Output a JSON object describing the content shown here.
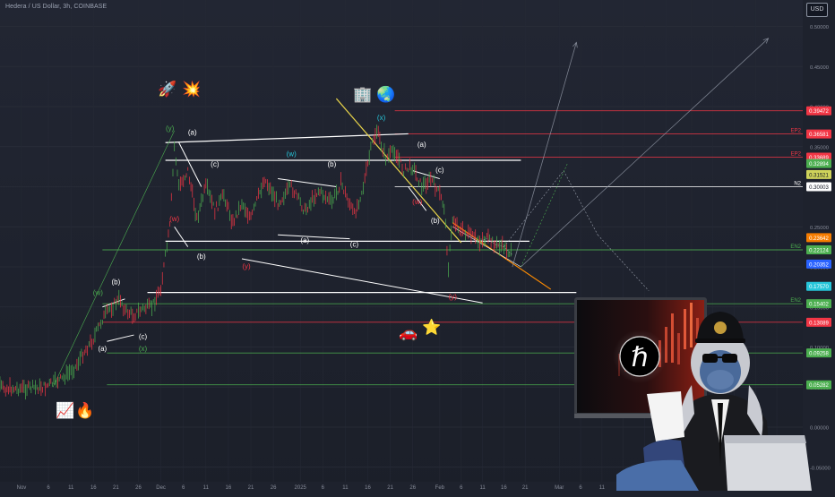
{
  "header": {
    "symbol_title": "Hedera / US Dollar, 3h, COINBASE",
    "currency": "USD"
  },
  "chart_data": {
    "type": "line",
    "title": "Hedera / US Dollar, 3h, COINBASE",
    "ylabel": "USD",
    "scale": "linear",
    "ylim": [
      -0.05,
      0.56
    ],
    "y_ticks": [
      "0.55000",
      "0.50000",
      "0.45000",
      "0.40000",
      "0.35000",
      "0.30000",
      "0.25000",
      "0.20000",
      "0.15000",
      "0.10000",
      "0.05000",
      "0.00000",
      "-0.05000"
    ],
    "x_ticks": [
      "Nov",
      "6",
      "11",
      "16",
      "21",
      "26",
      "Dec",
      "6",
      "11",
      "16",
      "21",
      "26",
      "2025",
      "6",
      "11",
      "16",
      "21",
      "26",
      "Feb",
      "6",
      "11",
      "16",
      "21",
      "Mar",
      "6",
      "11",
      "16",
      "21",
      "26",
      "Apr",
      "6",
      "11",
      "16",
      "21"
    ],
    "price_path": [
      [
        "Oct 24",
        0.05
      ],
      [
        "Oct 30",
        0.048
      ],
      [
        "Nov 5",
        0.05
      ],
      [
        "Nov 9",
        0.06
      ],
      [
        "Nov 12",
        0.075
      ],
      [
        "Nov 14",
        0.095
      ],
      [
        "Nov 16",
        0.11
      ],
      [
        "Nov 18",
        0.135
      ],
      [
        "Nov 20",
        0.15
      ],
      [
        "Nov 22",
        0.16
      ],
      [
        "Nov 23",
        0.145
      ],
      [
        "Nov 25",
        0.14
      ],
      [
        "Nov 27",
        0.148
      ],
      [
        "Nov 29",
        0.15
      ],
      [
        "Dec 1",
        0.175
      ],
      [
        "Dec 3",
        0.25
      ],
      [
        "Dec 4",
        0.35
      ],
      [
        "Dec 5",
        0.3
      ],
      [
        "Dec 7",
        0.32
      ],
      [
        "Dec 9",
        0.26
      ],
      [
        "Dec 11",
        0.3
      ],
      [
        "Dec 13",
        0.27
      ],
      [
        "Dec 15",
        0.29
      ],
      [
        "Dec 17",
        0.255
      ],
      [
        "Dec 19",
        0.28
      ],
      [
        "Dec 21",
        0.26
      ],
      [
        "Dec 24",
        0.31
      ],
      [
        "Dec 27",
        0.28
      ],
      [
        "Dec 30",
        0.3
      ],
      [
        "Jan 2",
        0.27
      ],
      [
        "Jan 5",
        0.295
      ],
      [
        "Jan 8",
        0.28
      ],
      [
        "Jan 10",
        0.305
      ],
      [
        "Jan 13",
        0.265
      ],
      [
        "Jan 15",
        0.3
      ],
      [
        "Jan 17",
        0.355
      ],
      [
        "Jan 18",
        0.37
      ],
      [
        "Jan 20",
        0.335
      ],
      [
        "Jan 22",
        0.345
      ],
      [
        "Jan 24",
        0.32
      ],
      [
        "Jan 26",
        0.325
      ],
      [
        "Jan 28",
        0.3
      ],
      [
        "Jan 30",
        0.31
      ],
      [
        "Feb 1",
        0.29
      ],
      [
        "Feb 2",
        0.275
      ],
      [
        "Feb 3",
        0.2
      ],
      [
        "Feb 4",
        0.26
      ],
      [
        "Feb 6",
        0.245
      ],
      [
        "Feb 8",
        0.24
      ],
      [
        "Feb 10",
        0.232
      ],
      [
        "Feb 12",
        0.235
      ],
      [
        "Feb 14",
        0.228
      ],
      [
        "Feb 16",
        0.225
      ],
      [
        "Feb 18",
        0.215
      ]
    ],
    "price_labels": [
      {
        "value": 0.39472,
        "text": "0.39472",
        "color": "#f23645"
      },
      {
        "value": 0.36581,
        "text": "0.36581",
        "color": "#f23645"
      },
      {
        "value": 0.33689,
        "text": "0.33689",
        "color": "#f23645"
      },
      {
        "value": 0.32894,
        "text": "0.32894",
        "color": "#4caf50"
      },
      {
        "value": 0.31521,
        "text": "0.31521",
        "color": "#cfd35a"
      },
      {
        "value": 0.30003,
        "text": "0.30003",
        "color": "#ffffff"
      },
      {
        "value": 0.23642,
        "text": "0.23642",
        "color": "#f57c00"
      },
      {
        "value": 0.22124,
        "text": "0.22124",
        "color": "#4caf50"
      },
      {
        "value": 0.20352,
        "text": "0.20352",
        "color": "#2962ff"
      },
      {
        "value": 0.1757,
        "text": "0.17570",
        "color": "#26c6da"
      },
      {
        "value": 0.15402,
        "text": "0.15402",
        "color": "#4caf50"
      },
      {
        "value": 0.13089,
        "text": "0.13089",
        "color": "#f23645"
      },
      {
        "value": 0.09258,
        "text": "0.09258",
        "color": "#4caf50"
      },
      {
        "value": 0.05282,
        "text": "0.05282",
        "color": "#4caf50"
      }
    ],
    "level_lines": [
      {
        "value": 0.39472,
        "color": "#f23645",
        "tag": ""
      },
      {
        "value": 0.36581,
        "color": "#f23645",
        "tag": "EP2"
      },
      {
        "value": 0.33689,
        "color": "#f23645",
        "tag": "EP2"
      },
      {
        "value": 0.30003,
        "color": "#ffffff",
        "tag": "N2"
      },
      {
        "value": 0.22124,
        "color": "#4caf50",
        "tag": "EN2"
      },
      {
        "value": 0.15402,
        "color": "#4caf50",
        "tag": "EN2"
      },
      {
        "value": 0.13089,
        "color": "#f23645",
        "tag": ""
      },
      {
        "value": 0.09258,
        "color": "#4caf50",
        "tag": ""
      },
      {
        "value": 0.05282,
        "color": "#4caf50",
        "tag": ""
      }
    ],
    "wave_labels": [
      {
        "text": "(w)",
        "date": "Nov 17",
        "value": 0.165,
        "color": "#4caf50"
      },
      {
        "text": "(b)",
        "date": "Nov 21",
        "value": 0.178,
        "color": "#ffffff"
      },
      {
        "text": "(c)",
        "date": "Nov 27",
        "value": 0.11,
        "color": "#ffffff"
      },
      {
        "text": "(a)",
        "date": "Nov 18",
        "value": 0.095,
        "color": "#ffffff"
      },
      {
        "text": "(x)",
        "date": "Nov 27",
        "value": 0.095,
        "color": "#4caf50"
      },
      {
        "text": "(y)",
        "date": "Dec 3",
        "value": 0.37,
        "color": "#4caf50"
      },
      {
        "text": "(a)",
        "date": "Dec 8",
        "value": 0.365,
        "color": "#ffffff"
      },
      {
        "text": "(c)",
        "date": "Dec 13",
        "value": 0.325,
        "color": "#ffffff"
      },
      {
        "text": "(w)",
        "date": "Dec 4",
        "value": 0.257,
        "color": "#f23645"
      },
      {
        "text": "(b)",
        "date": "Dec 10",
        "value": 0.21,
        "color": "#ffffff"
      },
      {
        "text": "(y)",
        "date": "Dec 20",
        "value": 0.198,
        "color": "#f23645"
      },
      {
        "text": "(w)",
        "date": "Dec 30",
        "value": 0.338,
        "color": "#26c6da"
      },
      {
        "text": "(b)",
        "date": "Jan 8",
        "value": 0.325,
        "color": "#ffffff"
      },
      {
        "text": "(a)",
        "date": "Jan 2",
        "value": 0.23,
        "color": "#ffffff"
      },
      {
        "text": "(c)",
        "date": "Jan 13",
        "value": 0.225,
        "color": "#ffffff"
      },
      {
        "text": "(x)",
        "date": "Jan 19",
        "value": 0.383,
        "color": "#26c6da"
      },
      {
        "text": "(a)",
        "date": "Jan 28",
        "value": 0.35,
        "color": "#ffffff"
      },
      {
        "text": "(c)",
        "date": "Feb 1",
        "value": 0.318,
        "color": "#ffffff"
      },
      {
        "text": "(w)",
        "date": "Jan 27",
        "value": 0.278,
        "color": "#f23645"
      },
      {
        "text": "(b)",
        "date": "Jan 31",
        "value": 0.255,
        "color": "#ffffff"
      },
      {
        "text": "(y)",
        "date": "Feb 4",
        "value": 0.16,
        "color": "#f23645"
      }
    ],
    "emojis": [
      {
        "icon": "🚀",
        "name": "rocket-icon"
      },
      {
        "icon": "💥",
        "name": "collision-icon"
      },
      {
        "icon": "🏢",
        "name": "office-building-icon"
      },
      {
        "icon": "🌏",
        "name": "globe-icon"
      },
      {
        "icon": "🚗",
        "name": "car-icon"
      },
      {
        "icon": "⭐",
        "name": "star-icon"
      },
      {
        "icon": "📈",
        "name": "chart-increasing-icon"
      },
      {
        "icon": "🔥",
        "name": "fire-icon"
      }
    ],
    "grid": true
  },
  "overlay": {
    "logo_symbol": "ℏ"
  },
  "colors": {
    "background": "#1e222d",
    "candle_up": "#4caf50",
    "candle_down": "#f23645",
    "trendline_yellow": "#e8d44a",
    "trendline_orange": "#ff8c00",
    "current_price": "#2962ff",
    "projection": "#9aa0ad"
  }
}
